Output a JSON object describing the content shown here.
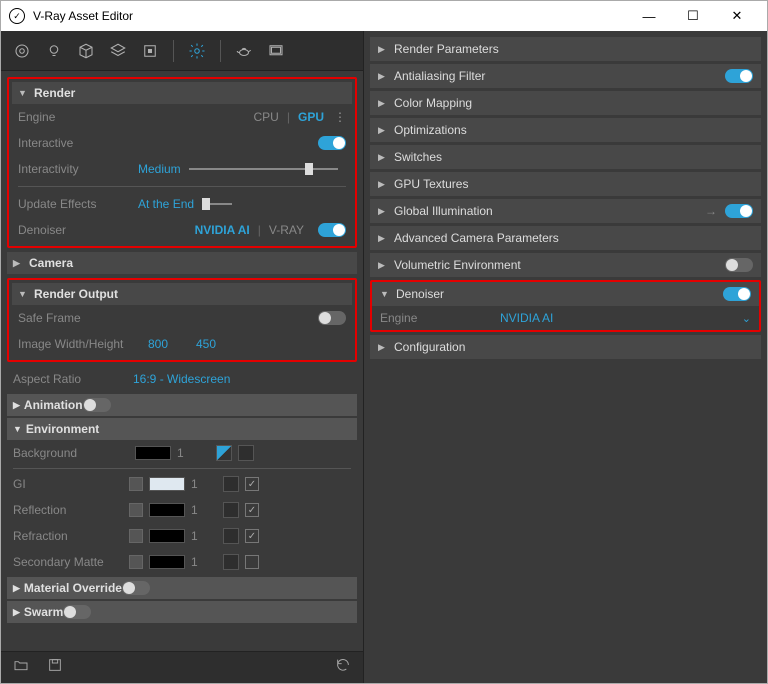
{
  "window": {
    "title": "V-Ray Asset Editor"
  },
  "left": {
    "render": {
      "title": "Render",
      "engine_label": "Engine",
      "engine_cpu": "CPU",
      "engine_gpu": "GPU",
      "interactive_label": "Interactive",
      "interactive_on": true,
      "interactivity_label": "Interactivity",
      "interactivity_value": "Medium",
      "update_effects_label": "Update Effects",
      "update_effects_value": "At the End",
      "denoiser_label": "Denoiser",
      "denoiser_nvidia": "NVIDIA AI",
      "denoiser_vray": "V-RAY",
      "denoiser_on": true
    },
    "camera": {
      "title": "Camera"
    },
    "render_output": {
      "title": "Render Output",
      "safe_frame_label": "Safe Frame",
      "safe_frame_on": false,
      "iwh_label": "Image Width/Height",
      "width": "800",
      "height": "450"
    },
    "aspect_label": "Aspect Ratio",
    "aspect_value": "16:9 - Widescreen",
    "animation": {
      "title": "Animation",
      "on": false
    },
    "environment": {
      "title": "Environment",
      "background_label": "Background",
      "gi_label": "GI",
      "reflection_label": "Reflection",
      "refraction_label": "Refraction",
      "secondary_label": "Secondary Matte",
      "mult": "1"
    },
    "material_override": {
      "title": "Material Override",
      "on": false
    },
    "swarm": {
      "title": "Swarm",
      "on": false
    }
  },
  "right": {
    "items": [
      {
        "label": "Render Parameters",
        "toggle": null
      },
      {
        "label": "Antialiasing Filter",
        "toggle": true
      },
      {
        "label": "Color Mapping",
        "toggle": null
      },
      {
        "label": "Optimizations",
        "toggle": null
      },
      {
        "label": "Switches",
        "toggle": null
      },
      {
        "label": "GPU Textures",
        "toggle": null
      },
      {
        "label": "Global Illumination",
        "toggle": true,
        "arrow_out": true
      },
      {
        "label": "Advanced Camera Parameters",
        "toggle": null
      },
      {
        "label": "Volumetric Environment",
        "toggle": false
      }
    ],
    "denoiser": {
      "label": "Denoiser",
      "on": true,
      "engine_label": "Engine",
      "engine_value": "NVIDIA AI"
    },
    "config": {
      "label": "Configuration"
    }
  }
}
